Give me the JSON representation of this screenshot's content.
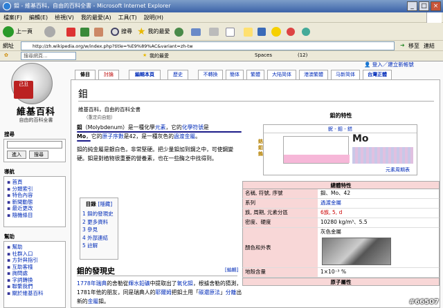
{
  "window": {
    "title": "鉬 - 維基百科，自由的百科全書 - Microsoft Internet Explorer"
  },
  "menu": [
    "檔案(F)",
    "編輯(E)",
    "檢視(V)",
    "我的最愛(A)",
    "工具(T)",
    "說明(H)"
  ],
  "toolbar": {
    "back": "上一頁",
    "search": "搜尋",
    "favorites": "我的最愛"
  },
  "address": {
    "url": "http://zh.wikipedia.org/w/index.php?title=%E9%89%AC&variant=zh-tw",
    "go": "移至",
    "links": "連結"
  },
  "links_bar": {
    "search_placeholder": "搜尋網頁...",
    "favorites": "我的最愛",
    "spaces": "Spaces",
    "count": "(12)"
  },
  "logo": {
    "name": "維基百科",
    "tagline": "自由的百科全書",
    "seal": "己丑"
  },
  "sidebar": {
    "search_head": "搜尋",
    "go_button": "進入",
    "search_button": "搜尋",
    "nav_head": "導航",
    "nav_items": [
      "首頁",
      "分類索引",
      "特色內容",
      "新聞動態",
      "最近更改",
      "隨機條目"
    ],
    "help_head": "幫助",
    "help_items": [
      "幫助",
      "社群入口",
      "方針與指引",
      "互助客棧",
      "詢問處",
      "字詞轉換",
      "聯繫我們",
      "關於維基百科"
    ]
  },
  "personal": {
    "login": "登入／建立新帳號"
  },
  "tabs": [
    "條目",
    "討論",
    "編輯本頁",
    "歷史",
    "不轉換",
    "簡体",
    "繁體",
    "大陆简体",
    "港澳繁體",
    "马新简体",
    "台灣正體"
  ],
  "article": {
    "title": "鉬",
    "from": "維基百科，自由的百科全書",
    "redirect": "（重定向自鉬）",
    "p1": [
      "鉬",
      "（Molybdenum）是一種化學",
      "元素",
      "，它的",
      "化學符號",
      "是",
      "Mo",
      "，它的",
      "原子序數",
      "是42，是一種灰色的",
      "過渡金屬",
      "。"
    ],
    "p2": "鉬的純金屬是銀白色，非常堅硬。把少量鉬加到鋼之中，可使鋼變硬。鉬是對植物很重要的營養素，也在一些酶之中找得到。",
    "toc_title": "目錄",
    "toc_hide": "[隱藏]",
    "toc": [
      "1 鉬的發現史",
      "2 更多資料",
      "3 參見",
      "4 外部連結",
      "5 註解"
    ],
    "h2": "鉬的發現史",
    "edit": "[編輯]",
    "p3": [
      "1778年",
      "瑞典",
      "的舍勒從",
      "輝水鉛礦",
      "中提取出了",
      "氧化鉬",
      "，根據舍勒的猜測，1781年他的朋友，同是瑞典人的",
      "耶爾姆",
      "把鉬土用「",
      "碳還原法",
      "」",
      "分離",
      "出新的",
      "金屬",
      "鉬。"
    ]
  },
  "infobox": {
    "title": "鉬的特性",
    "img_caption": "鈮 - 鉬 - 鎝",
    "side_label": "鉻 鉬 鎢",
    "mo_symbol": "Mo",
    "table_link": "元素周期表",
    "general_head": "總體特性",
    "rows": [
      {
        "k": "名稱, 符號, 序號",
        "v": "鉬、Mo、42"
      },
      {
        "k": "系列",
        "v": "過渡金屬"
      },
      {
        "k": "族, 周期, 元素分區",
        "v": "6族, 5, d"
      },
      {
        "k": "密度、硬度",
        "v": "10280 kg/m³、5.5"
      },
      {
        "k": "顏色和外表",
        "v": "灰色金屬"
      },
      {
        "k": "地殼含量",
        "v": "1×10⁻³ %"
      }
    ],
    "atomic_head": "原子屬性"
  },
  "watermark": "#66507"
}
